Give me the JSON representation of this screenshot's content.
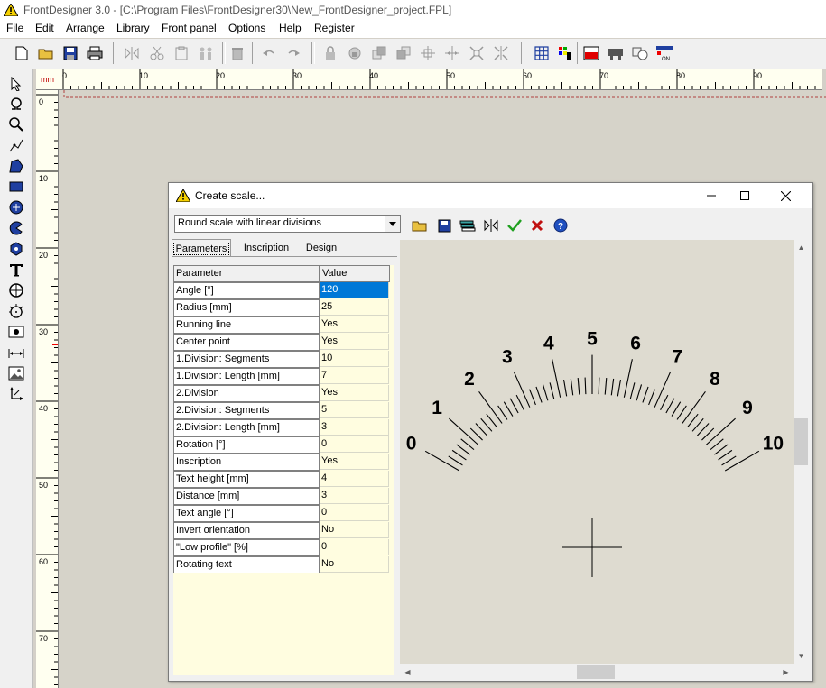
{
  "window": {
    "title": "FrontDesigner 3.0 - [C:\\Program Files\\FrontDesigner30\\New_FrontDesigner_project.FPL]"
  },
  "menu": [
    "File",
    "Edit",
    "Arrange",
    "Library",
    "Front panel",
    "Options",
    "Help",
    "Register"
  ],
  "ruler": {
    "unit": "mm",
    "h_labels": [
      "0",
      "10",
      "20",
      "30",
      "40",
      "50",
      "60",
      "70",
      "80",
      "90"
    ],
    "v_labels": [
      "0",
      "10",
      "20",
      "30",
      "40",
      "50",
      "60",
      "70"
    ]
  },
  "dialog": {
    "title": "Create scale...",
    "scale_type": "Round scale with linear divisions",
    "tabs": [
      "Parameters",
      "Inscription",
      "Design"
    ],
    "table": {
      "headers": [
        "Parameter",
        "Value"
      ],
      "rows": [
        [
          "Angle [°]",
          "120"
        ],
        [
          "Radius [mm]",
          "25"
        ],
        [
          "Running line",
          "Yes"
        ],
        [
          "Center point",
          "Yes"
        ],
        [
          "1.Division: Segments",
          "10"
        ],
        [
          "1.Division: Length [mm]",
          "7"
        ],
        [
          "2.Division",
          "Yes"
        ],
        [
          "2.Division: Segments",
          "5"
        ],
        [
          "2.Division: Length [mm]",
          "3"
        ],
        [
          "Rotation [°]",
          "0"
        ],
        [
          "Inscription",
          "Yes"
        ],
        [
          "Text height [mm]",
          "4"
        ],
        [
          "Distance [mm]",
          "3"
        ],
        [
          "Text angle [°]",
          "0"
        ],
        [
          "Invert orientation",
          "No"
        ],
        [
          "\"Low profile\" [%]",
          "0"
        ],
        [
          "Rotating text",
          "No"
        ]
      ]
    },
    "scale": {
      "labels": [
        "0",
        "1",
        "2",
        "3",
        "4",
        "5",
        "6",
        "7",
        "8",
        "9",
        "10"
      ]
    }
  }
}
